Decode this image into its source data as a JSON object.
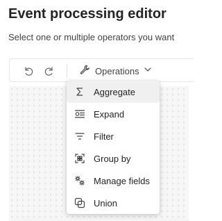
{
  "header": {
    "title": "Event processing editor",
    "subtitle": "Select one or multiple operators you want"
  },
  "toolbar": {
    "undo_icon": "undo-icon",
    "redo_icon": "redo-icon",
    "operations_label": "Operations",
    "operations_icon": "wrench-icon",
    "dropdown_icon": "chevron-down-icon"
  },
  "menu": {
    "items": [
      {
        "label": "Aggregate",
        "icon": "sigma-icon",
        "selected": true
      },
      {
        "label": "Expand",
        "icon": "expand-icon",
        "selected": false
      },
      {
        "label": "Filter",
        "icon": "filter-icon",
        "selected": false
      },
      {
        "label": "Group by",
        "icon": "group-by-icon",
        "selected": false
      },
      {
        "label": "Manage fields",
        "icon": "manage-fields-icon",
        "selected": false
      },
      {
        "label": "Union",
        "icon": "union-icon",
        "selected": false
      }
    ]
  },
  "colors": {
    "text_primary": "#242424",
    "text_secondary": "#424242",
    "menu_selected_bg": "#f0f0f0",
    "canvas_bg": "#f6f6f6"
  }
}
